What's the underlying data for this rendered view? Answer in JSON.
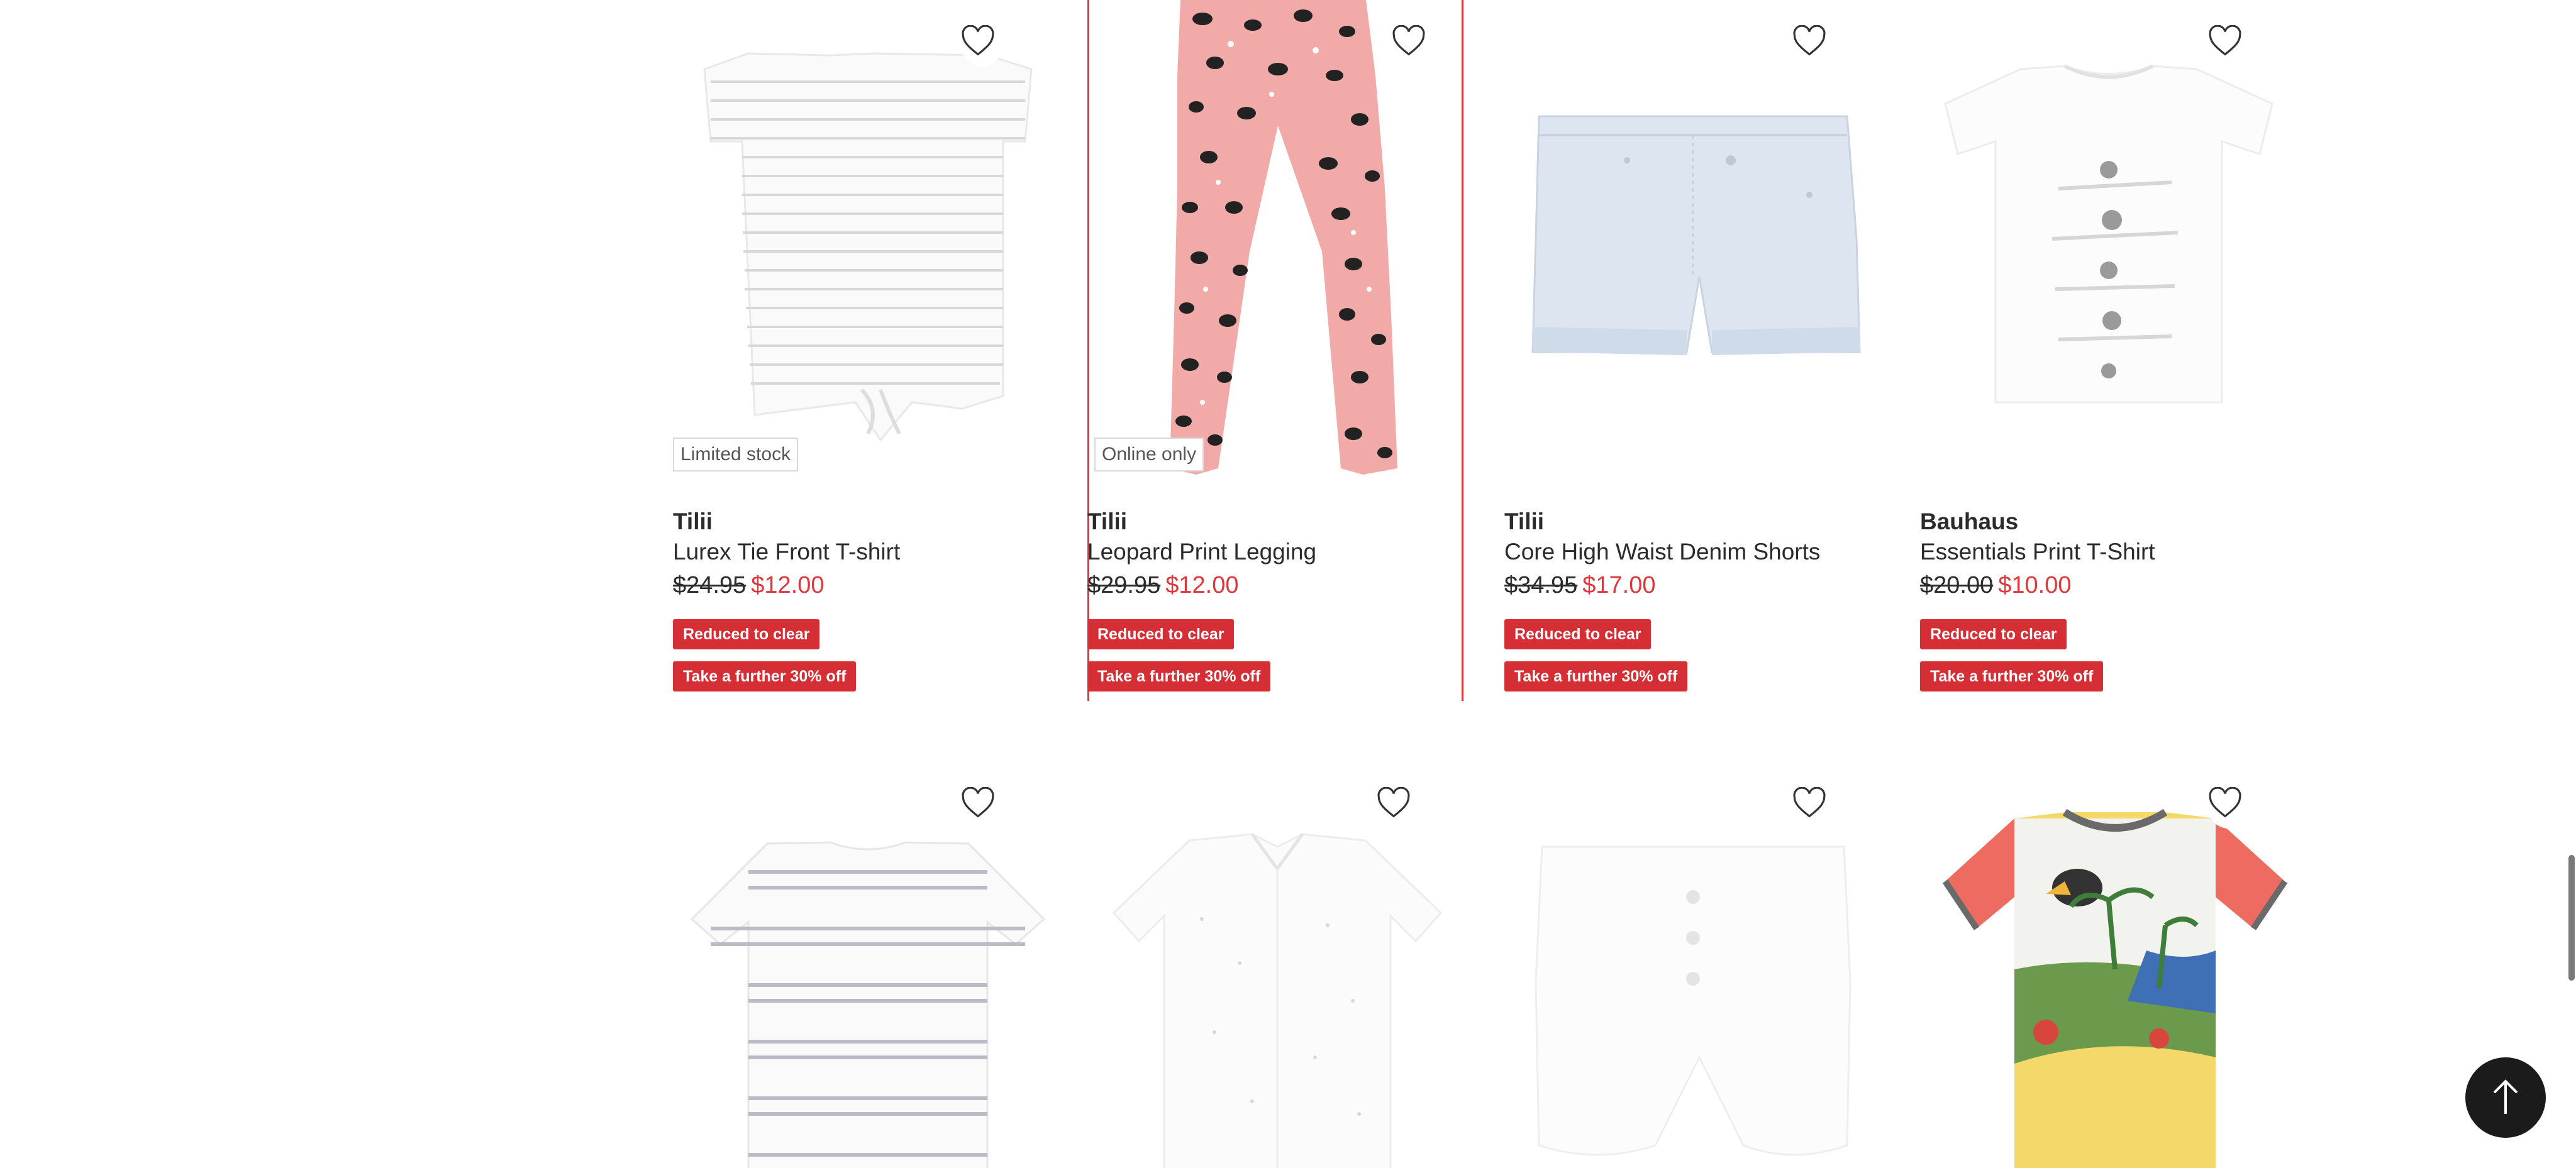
{
  "products_row1": [
    {
      "brand": "Tilii",
      "name": "Lurex Tie Front T-shirt",
      "was_price": "$24.95",
      "now_price": "$12.00",
      "tag": "Limited stock",
      "badges": [
        "Reduced to clear",
        "Take a further 30% off"
      ],
      "image": "striped-tshirt"
    },
    {
      "brand": "Tilii",
      "name": "Leopard Print Legging",
      "was_price": "$29.95",
      "now_price": "$12.00",
      "tag": "Online only",
      "badges": [
        "Reduced to clear",
        "Take a further 30% off"
      ],
      "image": "leopard-legging",
      "hovered": true
    },
    {
      "brand": "Tilii",
      "name": "Core High Waist Denim Shorts",
      "was_price": "$34.95",
      "now_price": "$17.00",
      "badges": [
        "Reduced to clear",
        "Take a further 30% off"
      ],
      "image": "denim-shorts"
    },
    {
      "brand": "Bauhaus",
      "name": "Essentials Print T-Shirt",
      "was_price": "$20.00",
      "now_price": "$10.00",
      "badges": [
        "Reduced to clear",
        "Take a further 30% off"
      ],
      "image": "print-tshirt"
    }
  ],
  "products_row2": [
    {
      "image": "striped-crew-tee"
    },
    {
      "image": "white-shirt"
    },
    {
      "image": "white-shorts"
    },
    {
      "image": "toucan-bodysuit"
    }
  ],
  "icons": {
    "favourite": "heart-outline-icon",
    "back_to_top": "arrow-up-icon"
  },
  "colors": {
    "sale_red": "#d62e35",
    "price_red": "#e0373c",
    "text": "#2b2b2b",
    "legging_pink": "#f1aaa8"
  }
}
